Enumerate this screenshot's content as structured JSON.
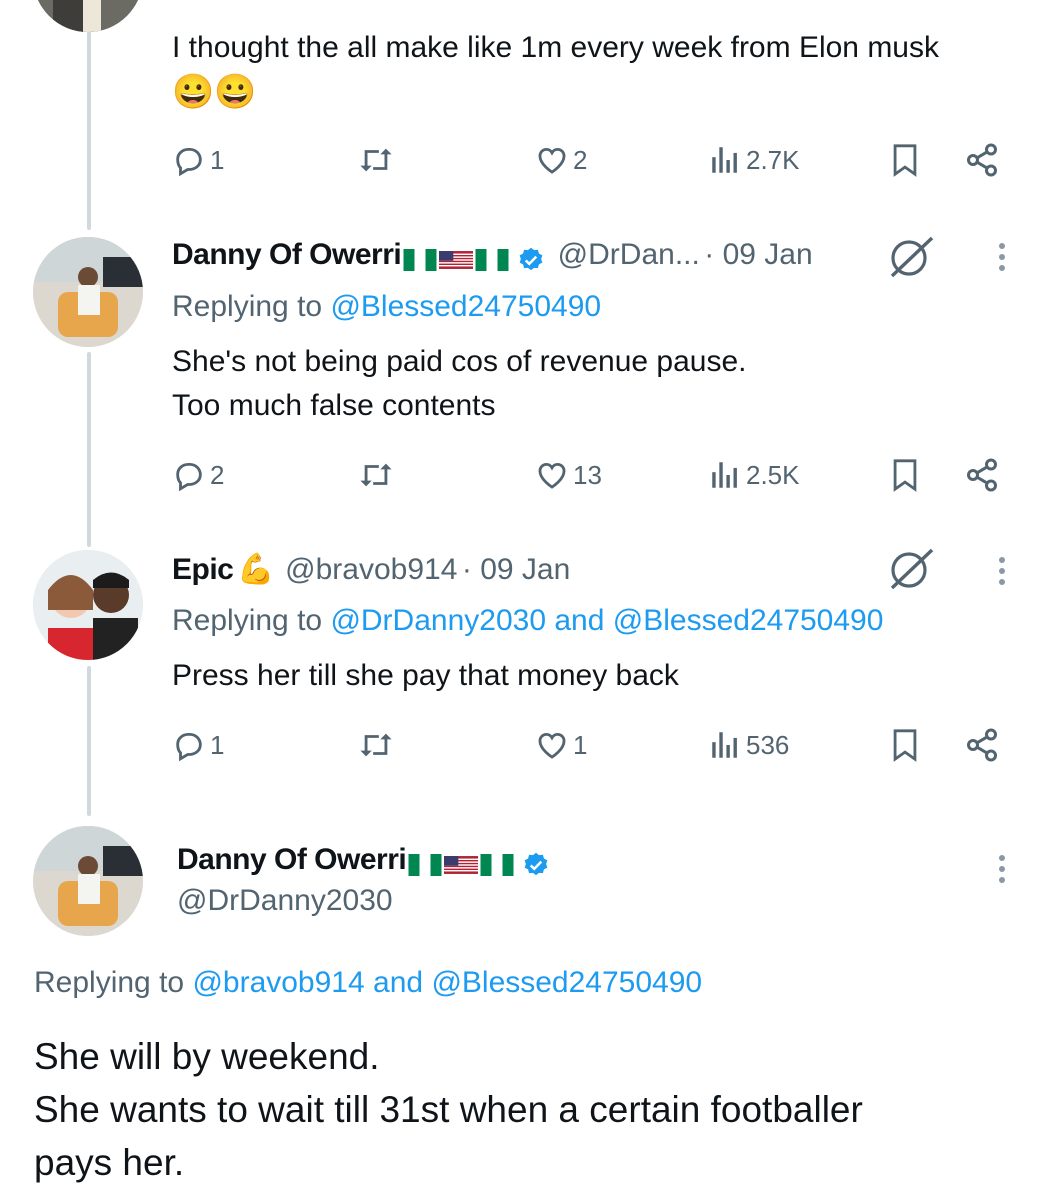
{
  "tweets": [
    {
      "body_lines": [
        "I thought the all make like 1m every week from Elon musk"
      ],
      "emoji": "😀😀",
      "stats": {
        "replies": "1",
        "likes": "2",
        "views": "2.7K"
      }
    },
    {
      "name": "Danny Of Owerri",
      "handle": "@DrDan...",
      "date": "· 09 Jan",
      "replying_label": "Replying to",
      "replying_to": "@Blessed24750490",
      "body_lines": [
        "She's not being paid cos of revenue pause.",
        "Too much false contents"
      ],
      "stats": {
        "replies": "2",
        "likes": "13",
        "views": "2.5K"
      }
    },
    {
      "name": "Epic",
      "name_emoji": "💪",
      "handle": "@bravob914",
      "date": "· 09 Jan",
      "replying_label": "Replying to",
      "replying_to_1": "@DrDanny2030",
      "replying_and": "and",
      "replying_to_2": "@Blessed24750490",
      "body_lines": [
        "Press her till she pay that money back"
      ],
      "stats": {
        "replies": "1",
        "likes": "1",
        "views": "536"
      }
    }
  ],
  "main_tweet": {
    "name": "Danny Of Owerri",
    "handle": "@DrDanny2030",
    "replying_label": "Replying to",
    "replying_to_1": "@bravob914",
    "replying_and": "and",
    "replying_to_2": "@Blessed24750490",
    "body_lines": [
      "She will by weekend.",
      "She wants to wait till 31st when a certain footballer",
      "pays her."
    ]
  },
  "colors": {
    "link": "#1d9bf0",
    "muted": "#536471",
    "verified": "#1d9bf0",
    "thread_line": "#cfd9de"
  }
}
